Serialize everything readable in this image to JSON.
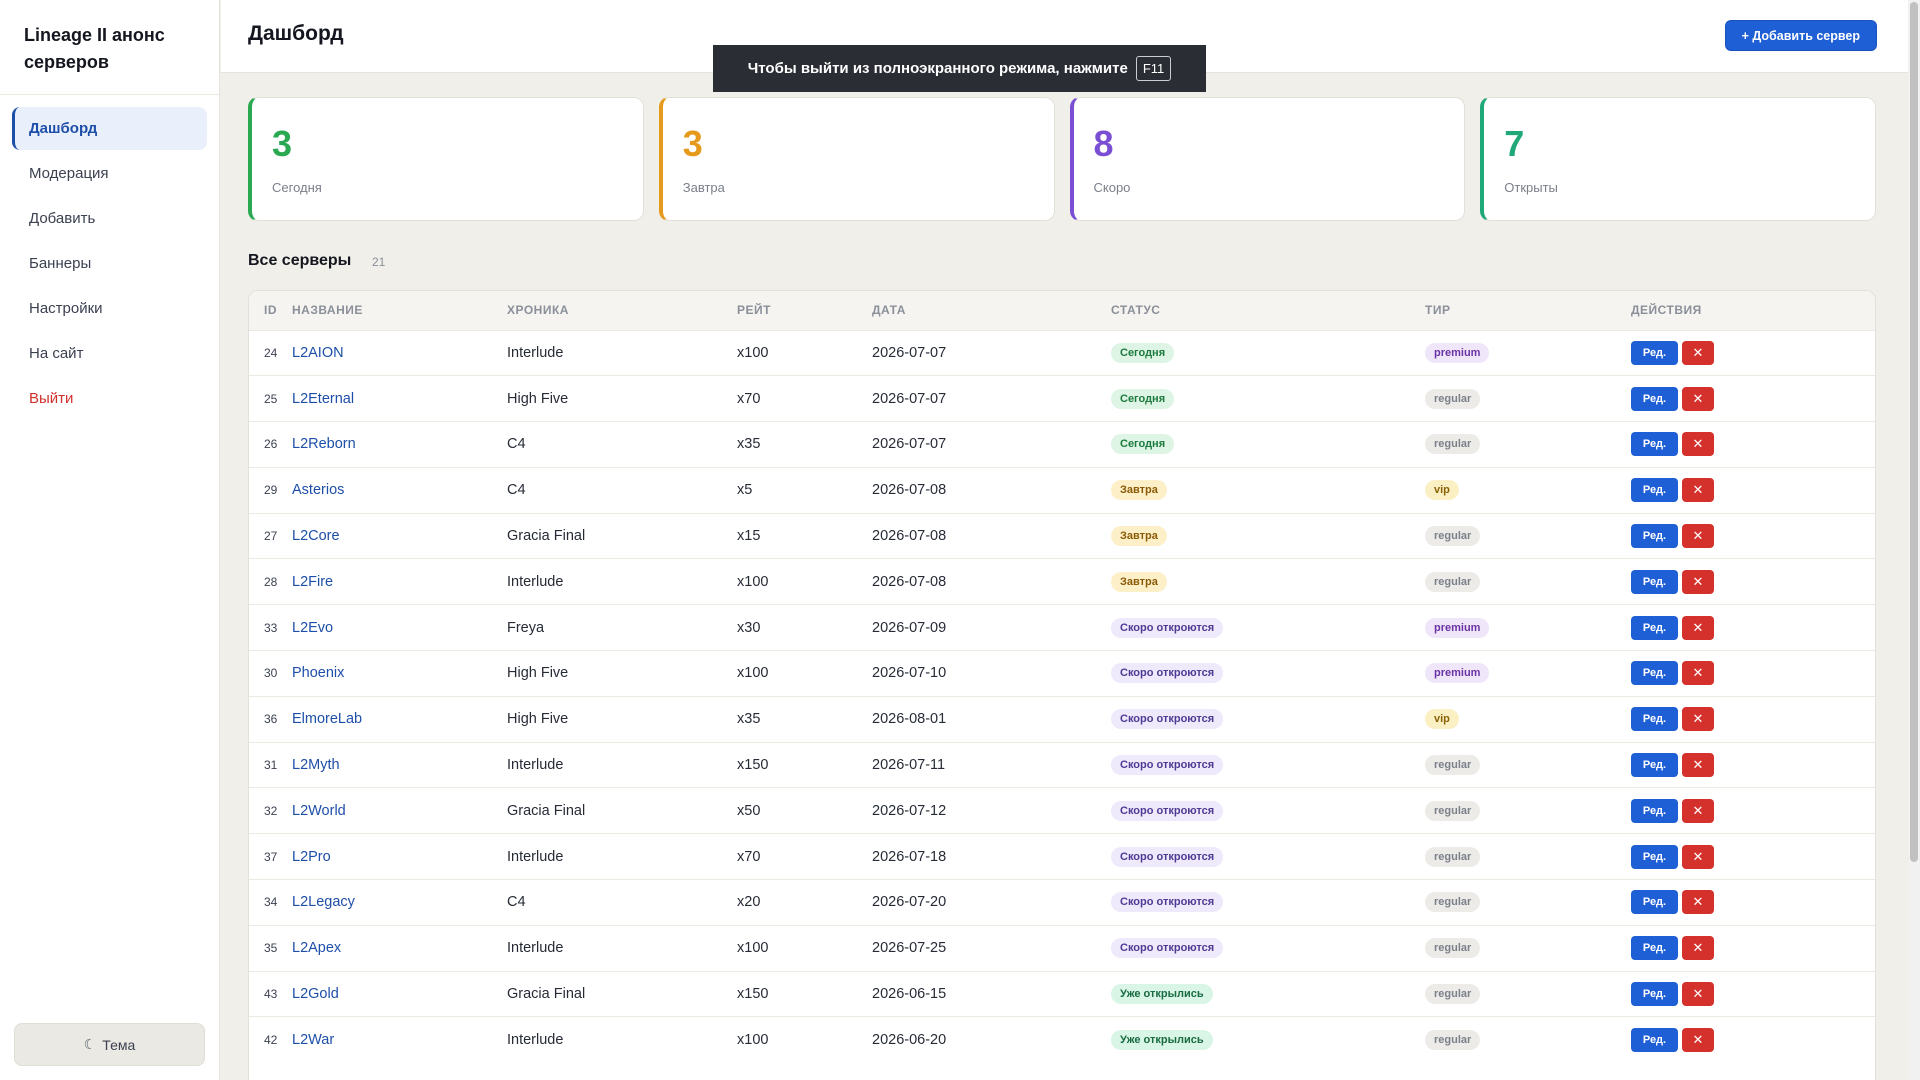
{
  "sidebar": {
    "brand": "Lineage II анонс серверов",
    "items": [
      {
        "label": "Дашборд",
        "active": true
      },
      {
        "label": "Модерация"
      },
      {
        "label": "Добавить"
      },
      {
        "label": "Баннеры"
      },
      {
        "label": "Настройки"
      },
      {
        "label": "На сайт"
      },
      {
        "label": "Выйти",
        "danger": true
      }
    ],
    "theme_label": "Тема",
    "theme_icon": "moon-icon"
  },
  "header": {
    "title": "Дашборд",
    "add_button": "+ Добавить сервер"
  },
  "toast": {
    "text": "Чтобы выйти из полноэкранного режима, нажмите",
    "key": "F11"
  },
  "stats": [
    {
      "value": "3",
      "label": "Сегодня",
      "color": "#2aa952"
    },
    {
      "value": "3",
      "label": "Завтра",
      "color": "#e69a1c"
    },
    {
      "value": "8",
      "label": "Скоро",
      "color": "#7b4fd4"
    },
    {
      "value": "7",
      "label": "Открыты",
      "color": "#1fa878"
    }
  ],
  "section": {
    "title": "Все серверы",
    "count": "21"
  },
  "table": {
    "headers": {
      "id": "ID",
      "name": "НАЗВАНИЕ",
      "chronicle": "ХРОНИКА",
      "rate": "РЕЙТ",
      "date": "ДАТА",
      "status": "СТАТУС",
      "tier": "ТИР",
      "actions": "ДЕЙСТВИЯ"
    },
    "edit_label": "Ред.",
    "delete_label": "✕",
    "rows": [
      {
        "id": "24",
        "name": "L2AION",
        "chronicle": "Interlude",
        "rate": "x100",
        "date": "2026-07-07",
        "status": "Сегодня",
        "status_kind": "today",
        "tier": "premium"
      },
      {
        "id": "25",
        "name": "L2Eternal",
        "chronicle": "High Five",
        "rate": "x70",
        "date": "2026-07-07",
        "status": "Сегодня",
        "status_kind": "today",
        "tier": "regular"
      },
      {
        "id": "26",
        "name": "L2Reborn",
        "chronicle": "C4",
        "rate": "x35",
        "date": "2026-07-07",
        "status": "Сегодня",
        "status_kind": "today",
        "tier": "regular"
      },
      {
        "id": "29",
        "name": "Asterios",
        "chronicle": "C4",
        "rate": "x5",
        "date": "2026-07-08",
        "status": "Завтра",
        "status_kind": "tomorrow",
        "tier": "vip"
      },
      {
        "id": "27",
        "name": "L2Core",
        "chronicle": "Gracia Final",
        "rate": "x15",
        "date": "2026-07-08",
        "status": "Завтра",
        "status_kind": "tomorrow",
        "tier": "regular"
      },
      {
        "id": "28",
        "name": "L2Fire",
        "chronicle": "Interlude",
        "rate": "x100",
        "date": "2026-07-08",
        "status": "Завтра",
        "status_kind": "tomorrow",
        "tier": "regular"
      },
      {
        "id": "33",
        "name": "L2Evo",
        "chronicle": "Freya",
        "rate": "x30",
        "date": "2026-07-09",
        "status": "Скоро откроются",
        "status_kind": "soon",
        "tier": "premium"
      },
      {
        "id": "30",
        "name": "Phoenix",
        "chronicle": "High Five",
        "rate": "x100",
        "date": "2026-07-10",
        "status": "Скоро откроются",
        "status_kind": "soon",
        "tier": "premium"
      },
      {
        "id": "36",
        "name": "ElmoreLab",
        "chronicle": "High Five",
        "rate": "x35",
        "date": "2026-08-01",
        "status": "Скоро откроются",
        "status_kind": "soon",
        "tier": "vip"
      },
      {
        "id": "31",
        "name": "L2Myth",
        "chronicle": "Interlude",
        "rate": "x150",
        "date": "2026-07-11",
        "status": "Скоро откроются",
        "status_kind": "soon",
        "tier": "regular"
      },
      {
        "id": "32",
        "name": "L2World",
        "chronicle": "Gracia Final",
        "rate": "x50",
        "date": "2026-07-12",
        "status": "Скоро откроются",
        "status_kind": "soon",
        "tier": "regular"
      },
      {
        "id": "37",
        "name": "L2Pro",
        "chronicle": "Interlude",
        "rate": "x70",
        "date": "2026-07-18",
        "status": "Скоро откроются",
        "status_kind": "soon",
        "tier": "regular"
      },
      {
        "id": "34",
        "name": "L2Legacy",
        "chronicle": "C4",
        "rate": "x20",
        "date": "2026-07-20",
        "status": "Скоро откроются",
        "status_kind": "soon",
        "tier": "regular"
      },
      {
        "id": "35",
        "name": "L2Apex",
        "chronicle": "Interlude",
        "rate": "x100",
        "date": "2026-07-25",
        "status": "Скоро откроются",
        "status_kind": "soon",
        "tier": "regular"
      },
      {
        "id": "43",
        "name": "L2Gold",
        "chronicle": "Gracia Final",
        "rate": "x150",
        "date": "2026-06-15",
        "status": "Уже открылись",
        "status_kind": "open",
        "tier": "regular"
      },
      {
        "id": "42",
        "name": "L2War",
        "chronicle": "Interlude",
        "rate": "x100",
        "date": "2026-06-20",
        "status": "Уже открылись",
        "status_kind": "open",
        "tier": "regular"
      }
    ]
  }
}
